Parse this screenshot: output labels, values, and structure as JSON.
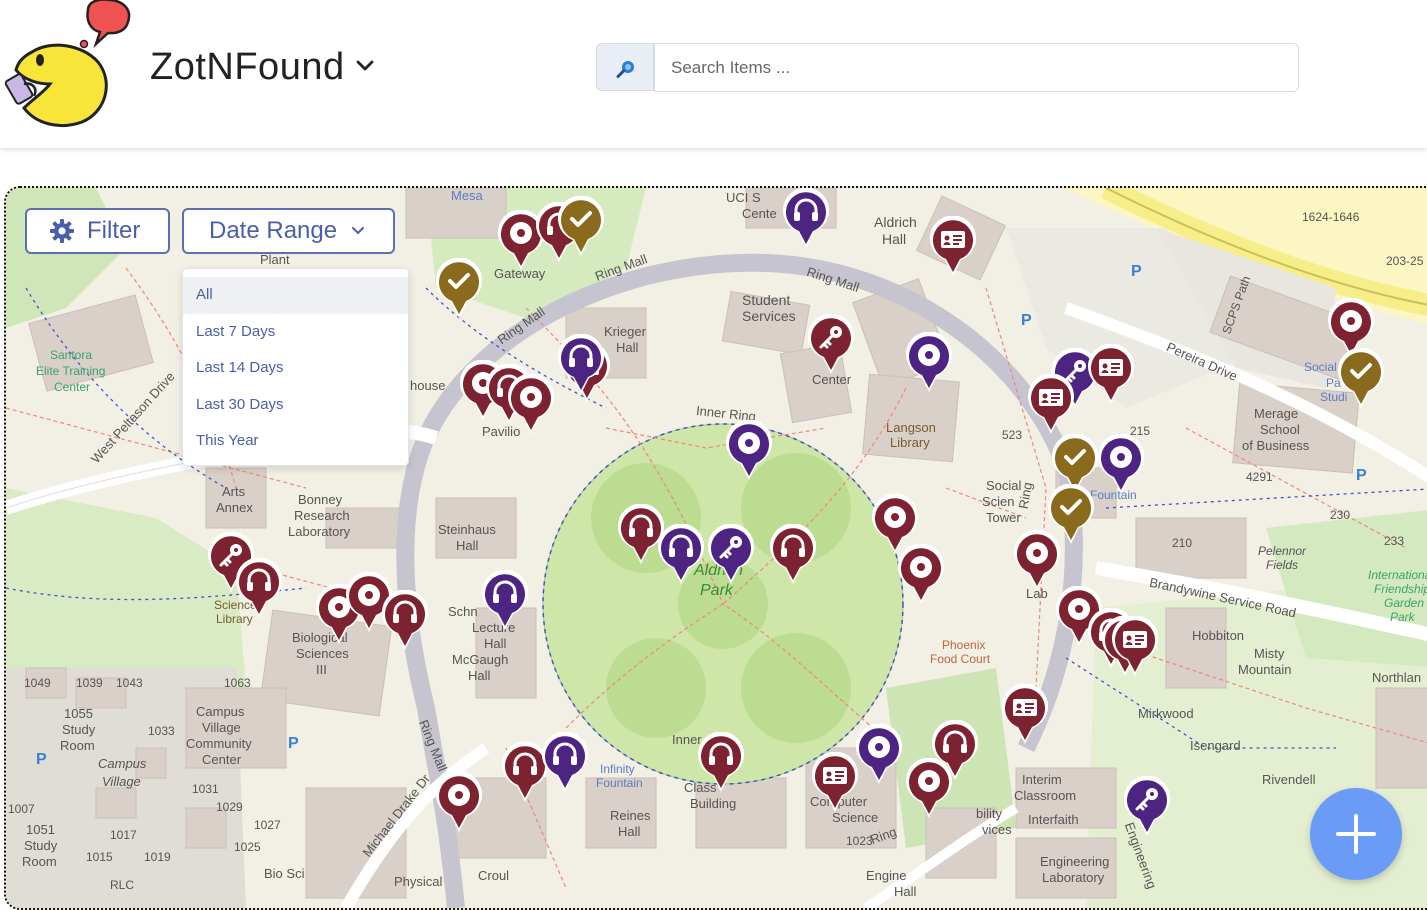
{
  "app": {
    "title": "ZotNFound"
  },
  "search": {
    "placeholder": "Search Items ..."
  },
  "map_controls": {
    "filter_label": "Filter",
    "date_range_label": "Date Range",
    "date_options": [
      "All",
      "Last 7 Days",
      "Last 14 Days",
      "Last 30 Days",
      "This Year"
    ],
    "selected_option": "All"
  },
  "map_labels": [
    "Mesa",
    "UCI S",
    "Cente",
    "Aldrich",
    "Hall",
    "Ring Mall",
    "Student",
    "Services",
    "Krieger",
    "Hall",
    "Inner Ring",
    "Center",
    "Langson",
    "Library",
    "Social",
    "Scien",
    "Tower",
    "Santora",
    "Elite Training",
    "Center",
    "West Peltason Drive",
    "Arts",
    "Annex",
    "Bonney",
    "Research",
    "Laboratory",
    "Steinhaus",
    "Hall",
    "Science",
    "Library",
    "Biological",
    "Sciences",
    "III",
    "Schn",
    "Lecture",
    "Hall",
    "McGaugh",
    "Hall",
    "Aldrich",
    "Park",
    "Phoenix",
    "Food Court",
    "Pereira Drive",
    "Merage",
    "School",
    "of Business",
    "Brandywine Service Road",
    "Hobbiton",
    "Misty",
    "Mountain",
    "Mirkwood",
    "Isengard",
    "Rivendell",
    "Northlan",
    "Pelennor",
    "Fields",
    "International",
    "Friendship",
    "Garden",
    "Park",
    "Campus",
    "Village",
    "Community",
    "Center",
    "1055",
    "Study",
    "Room",
    "1051",
    "Study",
    "Room",
    "Infinity",
    "Fountain",
    "Reines",
    "Hall",
    "Class",
    "Building",
    "Computer",
    "Science",
    "Interim",
    "Classroom",
    "Interfaith",
    "Engineering",
    "Laboratory",
    "Michael Drake Dr",
    "Ring Mall",
    "Croul",
    "Physical",
    "Bio Sci",
    "Fountain",
    "SCPS Path",
    "Gateway",
    "Pavilio",
    "Plant",
    "house",
    "1624-1646",
    "203-25",
    "Social",
    "Pa",
    "Studi",
    "4291",
    "215",
    "523",
    "210",
    "230",
    "233",
    "1049",
    "1039",
    "1043",
    "1063",
    "1033",
    "1031",
    "1029",
    "1027",
    "1025",
    "1007",
    "1017",
    "1015",
    "1019",
    "RLC",
    "Campus",
    "Village",
    "Engineering",
    "Lab",
    "Inner",
    "Ring",
    "1023",
    "Engine",
    "Hall",
    "Ring",
    "bility",
    "vices"
  ],
  "pin_colors": {
    "maroon": "#7d2230",
    "purple": "#4e2482",
    "gold": "#8a6a1c"
  },
  "pins": [
    {
      "icon": "record-icon",
      "color": "maroon"
    },
    {
      "icon": "headphones-icon",
      "color": "maroon"
    },
    {
      "icon": "check-icon",
      "color": "gold"
    },
    {
      "icon": "headphones-icon",
      "color": "purple"
    },
    {
      "icon": "id-card-icon",
      "color": "maroon"
    },
    {
      "icon": "check-icon",
      "color": "gold"
    },
    {
      "icon": "key-icon",
      "color": "maroon"
    },
    {
      "icon": "record-icon",
      "color": "purple"
    },
    {
      "icon": "record-icon",
      "color": "maroon"
    },
    {
      "icon": "headphones-icon",
      "color": "maroon"
    },
    {
      "icon": "record-icon",
      "color": "maroon"
    },
    {
      "icon": "headphones-icon",
      "color": "maroon"
    },
    {
      "icon": "headphones-icon",
      "color": "purple"
    },
    {
      "icon": "record-icon",
      "color": "purple"
    },
    {
      "icon": "record-icon",
      "color": "maroon"
    },
    {
      "icon": "check-icon",
      "color": "gold"
    },
    {
      "icon": "key-icon",
      "color": "purple"
    },
    {
      "icon": "id-card-icon",
      "color": "maroon"
    },
    {
      "icon": "id-card-icon",
      "color": "maroon"
    },
    {
      "icon": "record-icon",
      "color": "purple"
    },
    {
      "icon": "check-icon",
      "color": "gold"
    },
    {
      "icon": "check-icon",
      "color": "gold"
    },
    {
      "icon": "record-icon",
      "color": "maroon"
    },
    {
      "icon": "headphones-icon",
      "color": "maroon"
    },
    {
      "icon": "headphones-icon",
      "color": "purple"
    },
    {
      "icon": "key-icon",
      "color": "purple"
    },
    {
      "icon": "headphones-icon",
      "color": "maroon"
    },
    {
      "icon": "record-icon",
      "color": "maroon"
    },
    {
      "icon": "record-icon",
      "color": "maroon"
    },
    {
      "icon": "key-icon",
      "color": "maroon"
    },
    {
      "icon": "headphones-icon",
      "color": "maroon"
    },
    {
      "icon": "record-icon",
      "color": "maroon"
    },
    {
      "icon": "record-icon",
      "color": "maroon"
    },
    {
      "icon": "headphones-icon",
      "color": "maroon"
    },
    {
      "icon": "headphones-icon",
      "color": "purple"
    },
    {
      "icon": "record-icon",
      "color": "maroon"
    },
    {
      "icon": "headphones-icon",
      "color": "maroon"
    },
    {
      "icon": "record-icon",
      "color": "maroon"
    },
    {
      "icon": "id-card-icon",
      "color": "maroon"
    },
    {
      "icon": "headphones-icon",
      "color": "maroon"
    },
    {
      "icon": "headphones-icon",
      "color": "maroon"
    },
    {
      "icon": "headphones-icon",
      "color": "purple"
    },
    {
      "icon": "id-card-icon",
      "color": "maroon"
    },
    {
      "icon": "record-icon",
      "color": "purple"
    },
    {
      "icon": "headphones-icon",
      "color": "maroon"
    },
    {
      "icon": "record-icon",
      "color": "maroon"
    },
    {
      "icon": "id-card-icon",
      "color": "maroon"
    },
    {
      "icon": "key-icon",
      "color": "purple"
    },
    {
      "icon": "record-icon",
      "color": "maroon"
    }
  ],
  "fab": {
    "icon": "plus-icon"
  }
}
